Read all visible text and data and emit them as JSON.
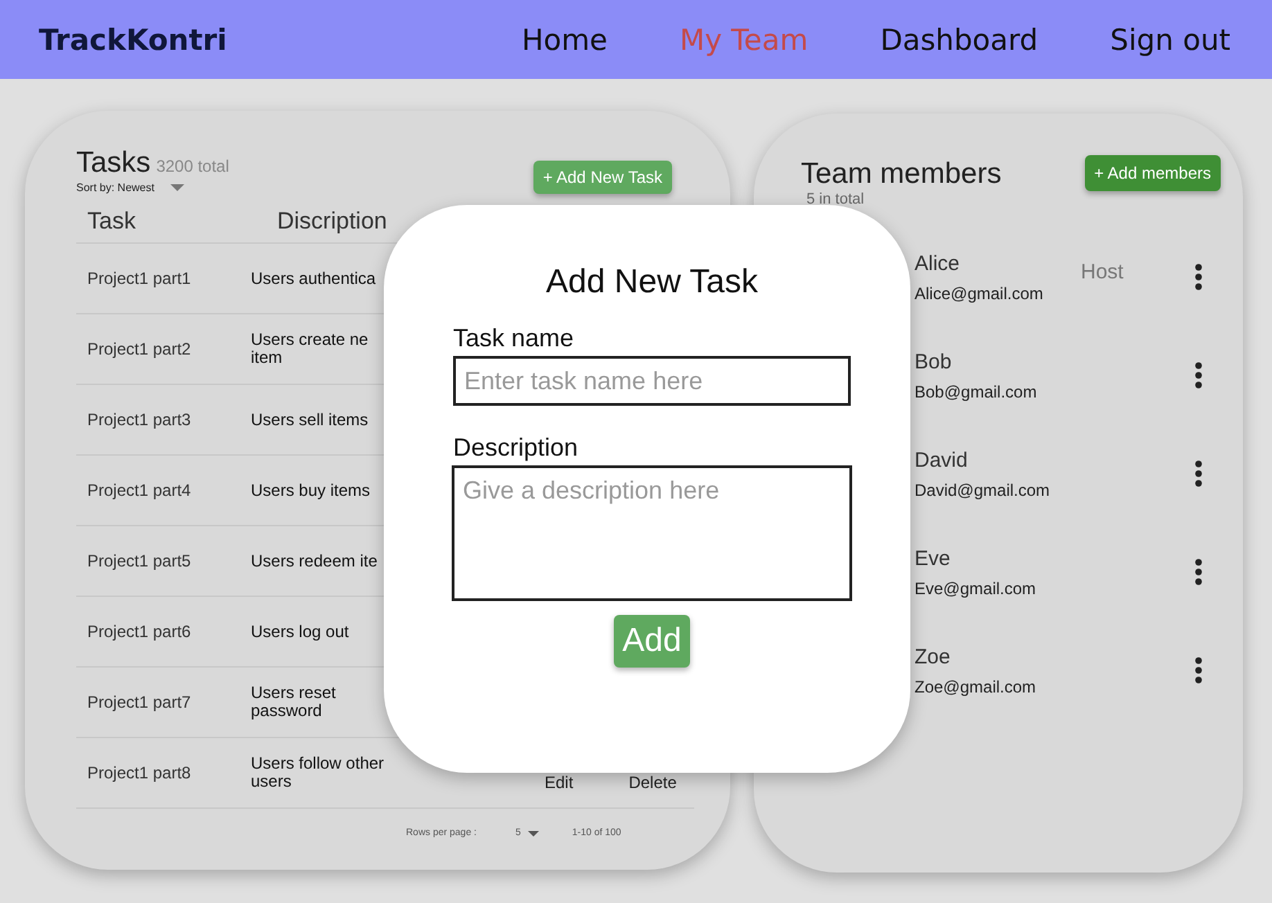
{
  "header": {
    "logo": "TrackKontri",
    "nav": [
      {
        "label": "Home",
        "selected": false
      },
      {
        "label": "My Team",
        "selected": true
      },
      {
        "label": "Dashboard",
        "selected": false
      },
      {
        "label": "Sign out",
        "selected": false
      }
    ]
  },
  "tasks_panel": {
    "title": "Tasks",
    "total": "3200 total",
    "sort": "Sort by: Newest",
    "add_button": "+ Add New Task",
    "columns": [
      "Task",
      "Discription"
    ],
    "rows": [
      {
        "task": "Project1 part1",
        "description": "Users authentica"
      },
      {
        "task": "Project1 part2",
        "description": "Users create ne item"
      },
      {
        "task": "Project1 part3",
        "description": "Users sell items"
      },
      {
        "task": "Project1 part4",
        "description": "Users buy items"
      },
      {
        "task": "Project1 part5",
        "description": "Users redeem ite"
      },
      {
        "task": "Project1 part6",
        "description": "Users log out"
      },
      {
        "task": "Project1 part7",
        "description": "Users reset password"
      },
      {
        "task": "Project1 part8",
        "description": "Users follow other users",
        "actions": [
          "Edit",
          "Delete"
        ]
      }
    ],
    "pagination": {
      "rows_per_page_label": "Rows per page :",
      "rows_per_page": "5",
      "range": "1-10 of 100"
    }
  },
  "team_panel": {
    "title": "Team members",
    "subtitle": "5 in total",
    "add_button": "+ Add members",
    "members": [
      {
        "name": "Alice",
        "email": "Alice@gmail.com",
        "role": "Host"
      },
      {
        "name": "Bob",
        "email": "Bob@gmail.com"
      },
      {
        "name": "David",
        "email": "David@gmail.com"
      },
      {
        "name": "Eve",
        "email": "Eve@gmail.com"
      },
      {
        "name": "Zoe",
        "email": "Zoe@gmail.com"
      }
    ]
  },
  "dialog": {
    "title": "Add New Task",
    "fields": [
      {
        "kind": "input",
        "label": "Task name",
        "placeholder": "Enter task name here"
      },
      {
        "kind": "textarea",
        "label": "Description",
        "placeholder": "Give a description here"
      }
    ],
    "submit": "Add"
  }
}
